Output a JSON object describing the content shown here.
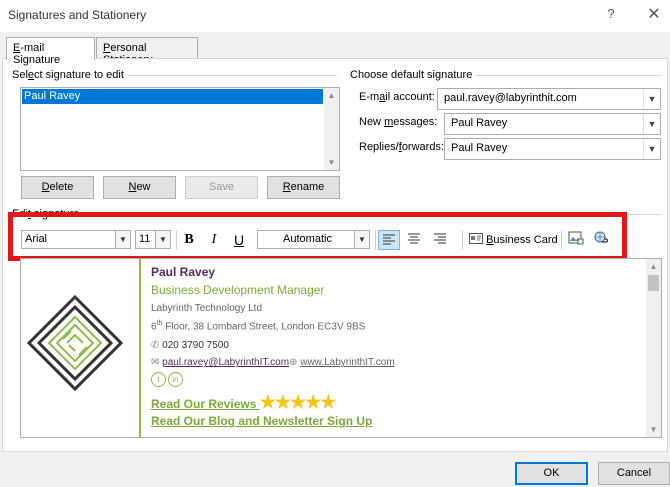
{
  "window": {
    "title": "Signatures and Stationery",
    "help": "?",
    "close": "✕"
  },
  "tabs": [
    {
      "label_pre": "",
      "label_u": "E",
      "label_post": "-mail Signature"
    },
    {
      "label_pre": "",
      "label_u": "P",
      "label_post": "ersonal Stationery"
    }
  ],
  "select_group": {
    "label_pre": "Sel",
    "label_u": "e",
    "label_post": "ct signature to edit",
    "items": [
      "Paul Ravey"
    ]
  },
  "buttons": {
    "delete_u": "D",
    "delete_post": "elete",
    "new_u": "N",
    "new_post": "ew",
    "save": "Save",
    "rename_u": "R",
    "rename_post": "ename"
  },
  "default_group": {
    "label": "Choose default signature",
    "email_account_pre": "E-m",
    "email_account_u": "a",
    "email_account_post": "il account:",
    "email_account_value": "paul.ravey@labyrinthit.com",
    "new_messages_pre": "New ",
    "new_messages_u": "m",
    "new_messages_post": "essages:",
    "new_messages_value": "Paul Ravey",
    "replies_pre": "Replies/",
    "replies_u": "f",
    "replies_post": "orwards:",
    "replies_value": "Paul Ravey"
  },
  "edit_group": {
    "label_pre": "Edi",
    "label_u": "t",
    "label_post": " signature"
  },
  "toolbar": {
    "font": "Arial",
    "size": "11",
    "bold": "B",
    "italic": "I",
    "underline": "U",
    "color": "Automatic",
    "business_card_u": "B",
    "business_card_post": "usiness Card",
    "accent": "#e01818"
  },
  "signature": {
    "name": "Paul Ravey",
    "job_title": "Business Development Manager",
    "company": "Labyrinth Technology Ltd",
    "address_floor": "6",
    "address_sup": "th",
    "address_rest": " Floor, 38 Lombard Street, London EC3V 9BS",
    "phone": "020 3790 7500",
    "email": "paul.ravey@LabyrinthIT.com",
    "website": "www.LabyrinthIT.com",
    "social": [
      "twitter-icon",
      "linkedin-icon"
    ],
    "reviews": "Read Our Reviews",
    "stars": "★★★★★",
    "blog": "Read Our Blog and Newsletter Sign Up",
    "colors": {
      "purple": "#5b2a5e",
      "green": "#7cab3a"
    }
  },
  "footer": {
    "ok": "OK",
    "cancel": "Cancel"
  }
}
